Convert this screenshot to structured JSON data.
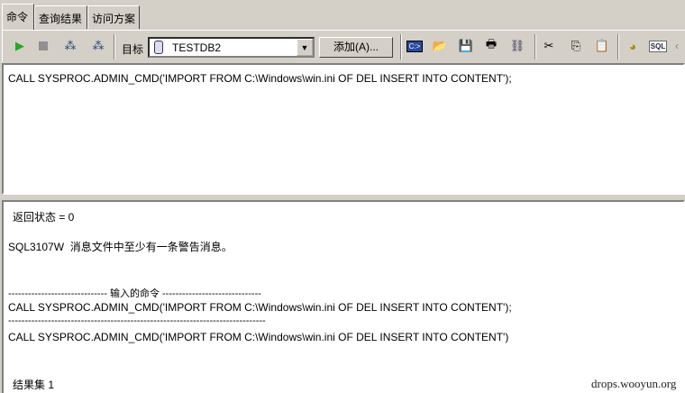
{
  "tabs": [
    {
      "label": "命令"
    },
    {
      "label": "查询结果"
    },
    {
      "label": "访问方案"
    }
  ],
  "toolbar": {
    "target_label": "目标",
    "target_value": "TESTDB2",
    "add_label": "添加(A)...",
    "sql_icon_text": "SQL"
  },
  "editor": {
    "text": "CALL SYSPROC.ADMIN_CMD('IMPORT FROM C:\\Windows\\win.ini OF DEL INSERT INTO CONTENT');"
  },
  "output": {
    "return_status": "返回状态 = 0",
    "warning": "SQL3107W  消息文件中至少有一条警告消息。",
    "divider_header": "------------------------------ 输入的命令 ------------------------------",
    "command_echo": "CALL SYSPROC.ADMIN_CMD('IMPORT FROM C:\\Windows\\win.ini OF DEL INSERT INTO CONTENT');",
    "divider": "------------------------------------------------------------------------------",
    "command_exec": "CALL SYSPROC.ADMIN_CMD('IMPORT FROM C:\\Windows\\win.ini OF DEL INSERT INTO CONTENT')",
    "result_set": "结果集 1"
  },
  "watermark": "drops.wooyun.org"
}
